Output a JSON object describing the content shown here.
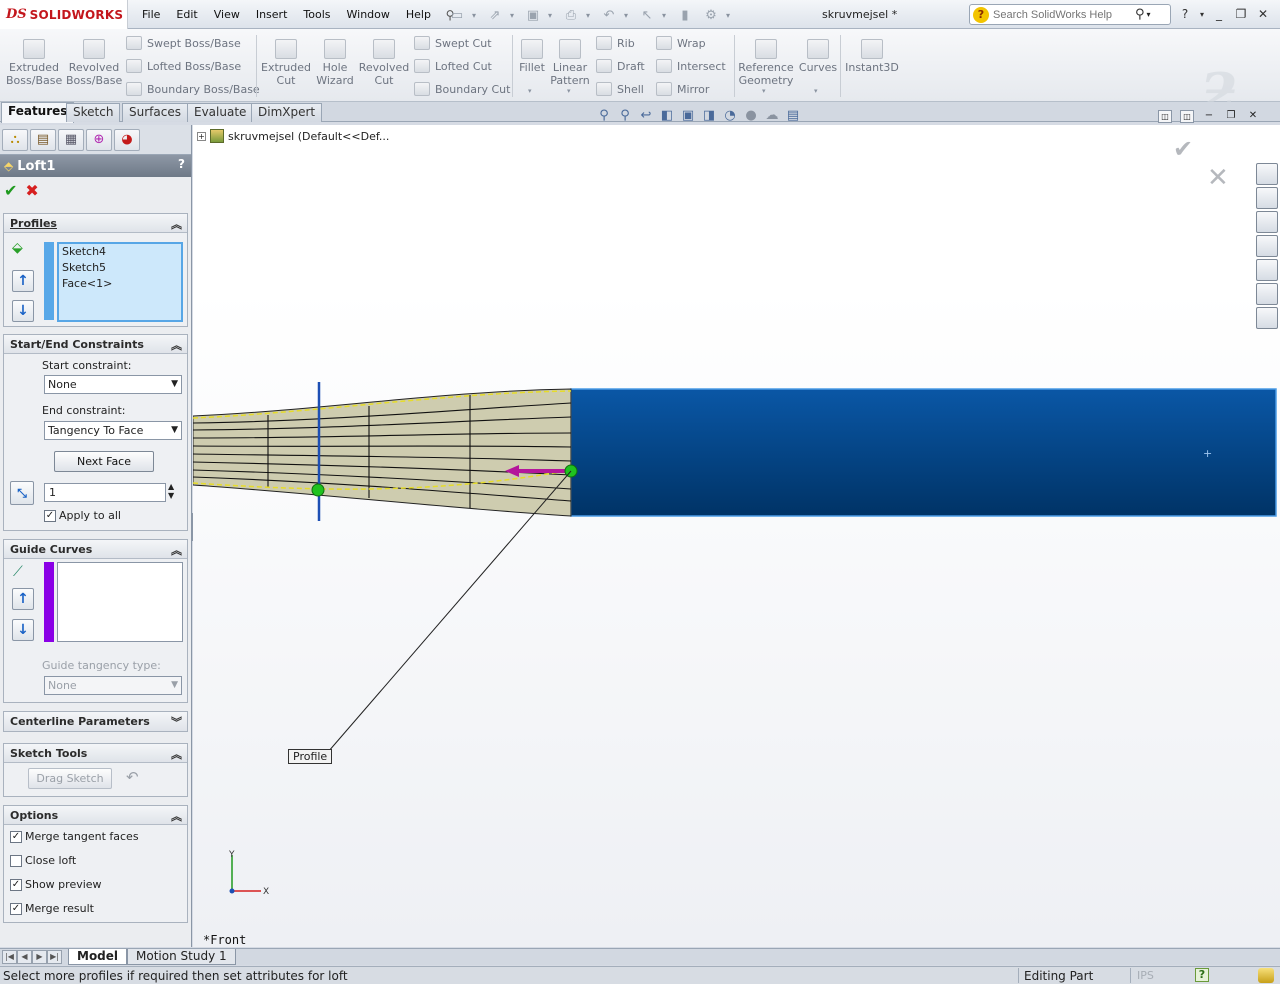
{
  "app": {
    "brand_ds": "DS",
    "brand_name": "SOLIDWORKS",
    "document_title": "skruvmejsel *",
    "menus": [
      "File",
      "Edit",
      "View",
      "Insert",
      "Tools",
      "Window",
      "Help"
    ],
    "search_placeholder": "Search SolidWorks Help"
  },
  "commands": {
    "extruded_boss": [
      "Extruded",
      "Boss/Base"
    ],
    "revolved_boss": [
      "Revolved",
      "Boss/Base"
    ],
    "swept_boss": "Swept Boss/Base",
    "lofted_boss": "Lofted Boss/Base",
    "boundary_boss": "Boundary Boss/Base",
    "extruded_cut": [
      "Extruded",
      "Cut"
    ],
    "hole_wizard": [
      "Hole",
      "Wizard"
    ],
    "revolved_cut": [
      "Revolved",
      "Cut"
    ],
    "swept_cut": "Swept Cut",
    "lofted_cut": "Lofted Cut",
    "boundary_cut": "Boundary Cut",
    "fillet": "Fillet",
    "linear_pattern": [
      "Linear",
      "Pattern"
    ],
    "rib": "Rib",
    "draft": "Draft",
    "shell": "Shell",
    "wrap": "Wrap",
    "intersect": "Intersect",
    "mirror": "Mirror",
    "reference_geometry": [
      "Reference",
      "Geometry"
    ],
    "curves": "Curves",
    "instant3d": "Instant3D"
  },
  "tabs": [
    "Features",
    "Sketch",
    "Surfaces",
    "Evaluate",
    "DimXpert"
  ],
  "active_tab": "Features",
  "property_manager": {
    "title": "Loft1",
    "help": "?",
    "profiles": {
      "header": "Profiles",
      "items": [
        "Sketch4",
        "Sketch5",
        "Face<1>"
      ]
    },
    "constraints": {
      "header": "Start/End Constraints",
      "start_label": "Start constraint:",
      "start_value": "None",
      "end_label": "End constraint:",
      "end_value": "Tangency To Face",
      "next_face": "Next Face",
      "tangent_length": "1",
      "apply_to_all": "Apply to all",
      "apply_to_all_checked": true
    },
    "guide_curves": {
      "header": "Guide Curves",
      "items": [],
      "tangency_label": "Guide tangency type:",
      "tangency_value": "None"
    },
    "centerline": {
      "header": "Centerline Parameters"
    },
    "sketch_tools": {
      "header": "Sketch Tools",
      "drag_sketch": "Drag Sketch"
    },
    "options": {
      "header": "Options",
      "items": [
        {
          "label": "Merge tangent faces",
          "checked": true
        },
        {
          "label": "Close loft",
          "checked": false
        },
        {
          "label": "Show preview",
          "checked": true
        },
        {
          "label": "Merge result",
          "checked": true
        }
      ]
    }
  },
  "graphics": {
    "tree_label": "skruvmejsel  (Default<<Def...",
    "callout": "Profile",
    "view_name": "*Front",
    "triad_x": "X",
    "triad_y": "Y",
    "colors": {
      "body_blue": "#0a4a8f",
      "loft_preview": "#c9c7a6",
      "connector_magenta": "#b4169b",
      "point_green": "#1fc21f",
      "plane_blue": "#1d4fb4"
    }
  },
  "bottom_tabs": [
    "Model",
    "Motion Study 1"
  ],
  "status": {
    "message": "Select more profiles if required then set attributes for loft",
    "mode": "Editing Part",
    "units": "IPS",
    "help": "?"
  }
}
